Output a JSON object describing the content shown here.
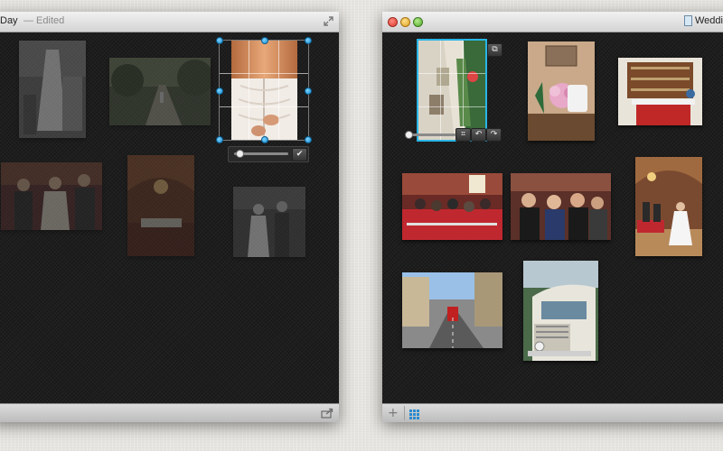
{
  "left_window": {
    "title_fragment": "Day",
    "edited_label": "— Edited",
    "fullscreen_icon": "expand-icon",
    "share_icon": "share-icon",
    "crop_slider": {
      "value": 0.1
    },
    "confirm_icon": "checkmark-icon",
    "photos": [
      {
        "name": "wedding-dress-mannequin"
      },
      {
        "name": "garden-path"
      },
      {
        "name": "dress-lacing-back"
      },
      {
        "name": "ceremony-group"
      },
      {
        "name": "hall-interior"
      },
      {
        "name": "couple-walking"
      }
    ]
  },
  "right_window": {
    "title_fragment": "Wedding",
    "add_icon": "plus-icon",
    "grid_icon": "grid-icon",
    "replace_icon": "replace-photo-icon",
    "crop_icon": "crop-icon",
    "rotate_left_icon": "rotate-left-icon",
    "rotate_right_icon": "rotate-right-icon",
    "zoom_slider": {
      "value": 0.0
    },
    "photos": [
      {
        "name": "town-street-fisheye"
      },
      {
        "name": "flower-arrangement"
      },
      {
        "name": "buffet-table"
      },
      {
        "name": "ceremony-seating"
      },
      {
        "name": "guests-seated"
      },
      {
        "name": "bride-walking-aisle"
      },
      {
        "name": "red-bus-street"
      },
      {
        "name": "vintage-bus"
      }
    ]
  },
  "colors": {
    "handle_blue": "#2a9ee0",
    "selection_cyan": "#29b6e6",
    "canvas": "#1e1e1e"
  }
}
